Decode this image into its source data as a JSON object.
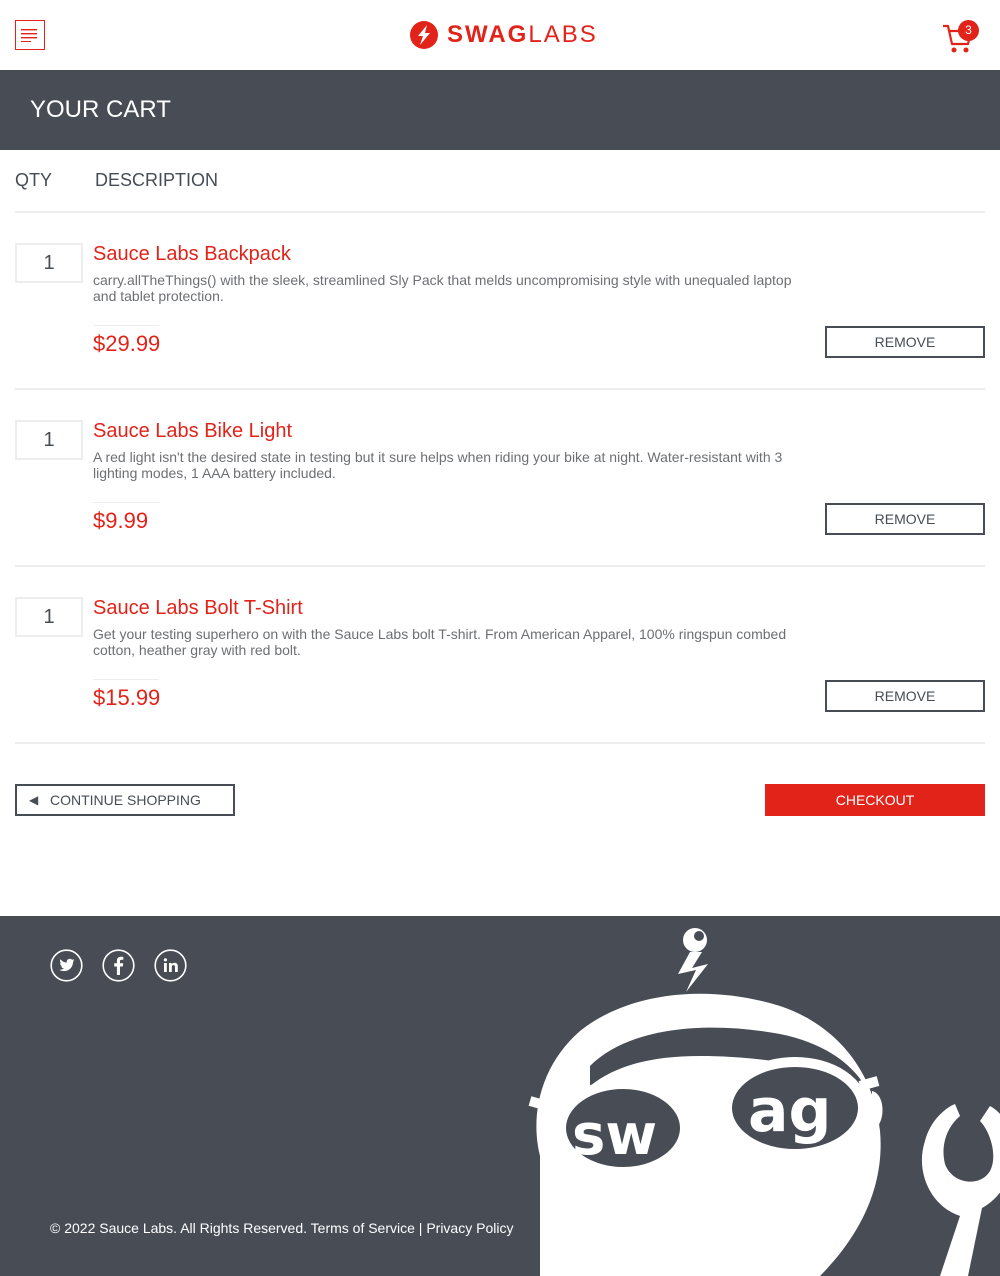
{
  "header": {
    "menu_icon": "hamburger-menu-icon",
    "logo": {
      "part1": "SWAG",
      "part2": "LABS"
    },
    "cart_icon": "shopping-cart-icon",
    "cart_count": "3"
  },
  "subheader": {
    "title": "YOUR CART"
  },
  "cart": {
    "columns": {
      "qty": "QTY",
      "description": "DESCRIPTION"
    },
    "items": [
      {
        "qty": "1",
        "name": "Sauce Labs Backpack",
        "description": "carry.allTheThings() with the sleek, streamlined Sly Pack that melds uncompromising style with unequaled laptop and tablet protection.",
        "price": "$29.99",
        "remove_label": "REMOVE"
      },
      {
        "qty": "1",
        "name": "Sauce Labs Bike Light",
        "description": "A red light isn't the desired state in testing but it sure helps when riding your bike at night. Water-resistant with 3 lighting modes, 1 AAA battery included.",
        "price": "$9.99",
        "remove_label": "REMOVE"
      },
      {
        "qty": "1",
        "name": "Sauce Labs Bolt T-Shirt",
        "description": "Get your testing superhero on with the Sauce Labs bolt T-shirt. From American Apparel, 100% ringspun combed cotton, heather gray with red bolt.",
        "price": "$15.99",
        "remove_label": "REMOVE"
      }
    ],
    "continue_label": "CONTINUE SHOPPING",
    "checkout_label": "CHECKOUT"
  },
  "footer": {
    "social": [
      "twitter-icon",
      "facebook-icon",
      "linkedin-icon"
    ],
    "copyright": "© 2022 Sauce Labs. All Rights Reserved. Terms of Service | Privacy Policy",
    "robot_text": "sw ag"
  },
  "colors": {
    "accent": "#e2231a",
    "dark": "#474c55",
    "divider": "#ededef"
  }
}
